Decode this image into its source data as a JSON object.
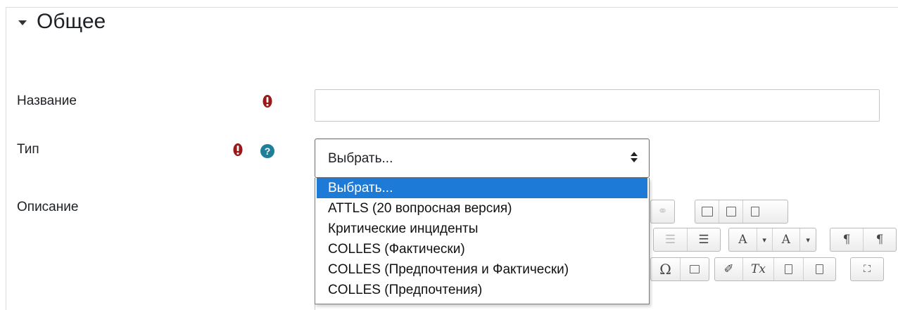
{
  "section": {
    "title": "Общее",
    "collapse_icon": "caret-down-icon"
  },
  "fields": {
    "name": {
      "label": "Название",
      "value": "",
      "required_icon": "exclamation-circle-icon"
    },
    "type": {
      "label": "Тип",
      "selected": "Выбрать...",
      "required_icon": "exclamation-circle-icon",
      "help_icon": "question-circle-icon",
      "help_glyph": "?"
    },
    "description": {
      "label": "Описание"
    }
  },
  "dropdown": {
    "options": [
      "Выбрать...",
      "ATTLS (20 вопросная версия)",
      "Критические инциденты",
      "COLLES (Фактически)",
      "COLLES (Предпочтения и Фактически)",
      "COLLES (Предпочтения)"
    ],
    "highlighted_index": 0
  },
  "editor_toolbar": {
    "glyphs": {
      "omega": "Ω",
      "clear_format": "Tx",
      "ltr": "¶",
      "rtl": "¶",
      "font_color": "A",
      "bg_color": "A",
      "dropdown": "▾"
    }
  },
  "colors": {
    "required": "#9a1818",
    "help": "#1f7e9a",
    "highlight": "#1e7ad7"
  }
}
